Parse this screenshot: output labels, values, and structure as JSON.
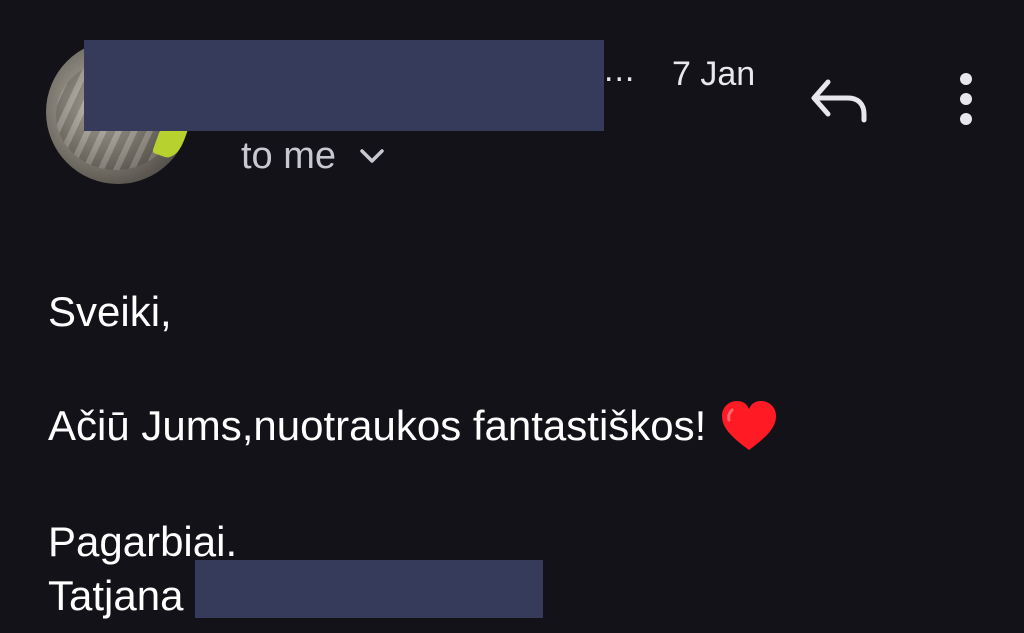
{
  "header": {
    "sender_ellipsis": "...",
    "date": "7 Jan",
    "recipient_label": "to me",
    "icons": {
      "reply": "reply-icon",
      "more": "more-vertical-icon",
      "expand": "chevron-down-icon"
    }
  },
  "body": {
    "greeting": "Sveiki,",
    "message": "Ačiū Jums,nuotraukos fantastiškos!",
    "closing": "Pagarbiai.",
    "signature_first_name": "Tatjana"
  },
  "colors": {
    "background": "#121218",
    "redaction": "#363b5c",
    "heart": "#ff1a24"
  }
}
